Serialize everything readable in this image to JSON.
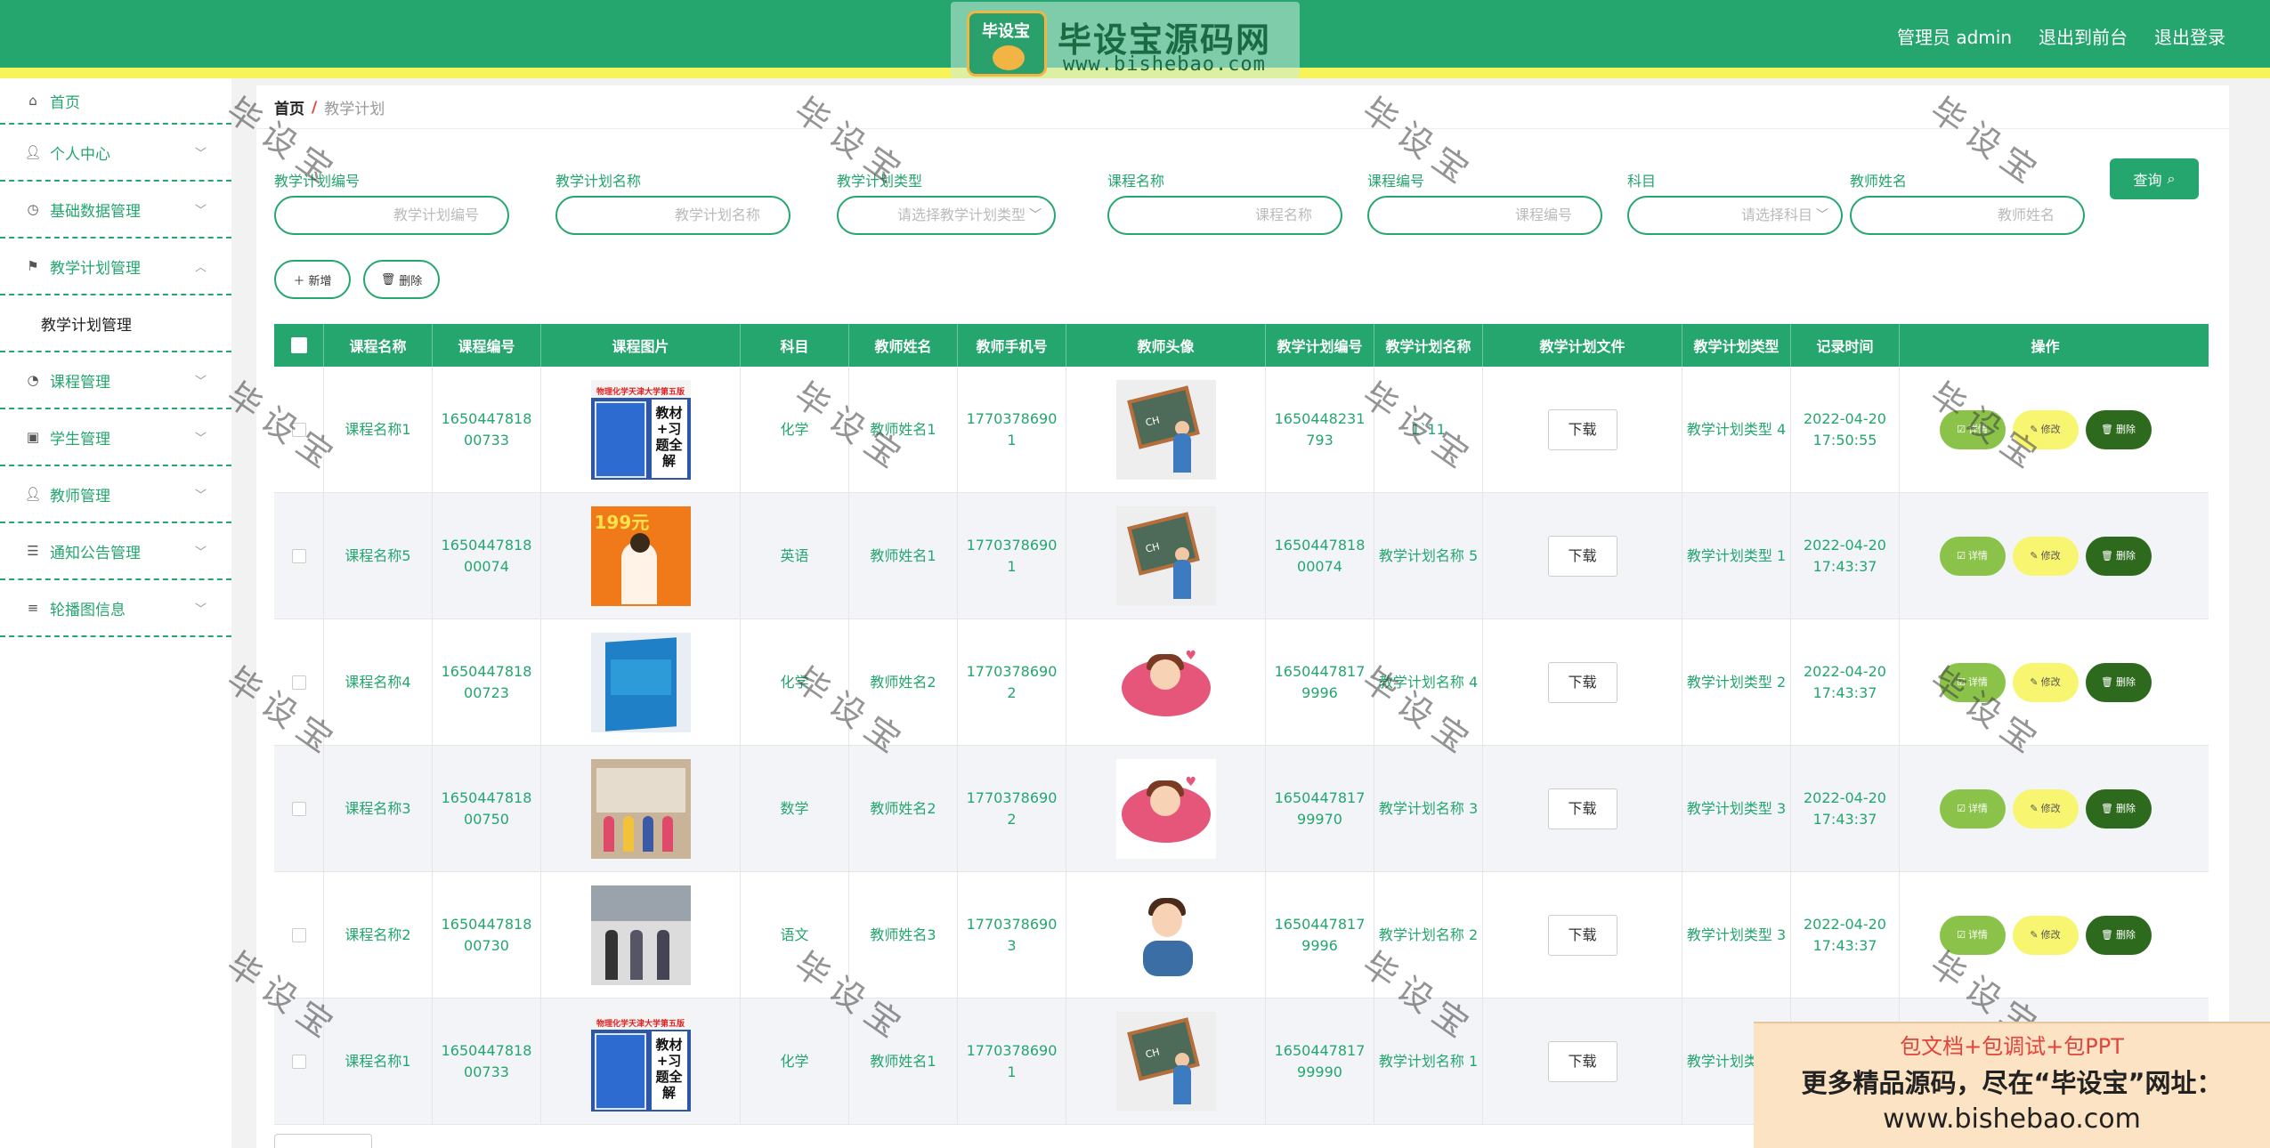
{
  "header": {
    "admin_label": "管理员 admin",
    "front_link": "退出到前台",
    "logout_link": "退出登录",
    "logo_badge": "毕设宝",
    "logo_title": "毕设宝源码网",
    "logo_url": "www.bishebao.com"
  },
  "sidebar": {
    "home": "首页",
    "items": [
      {
        "label": "个人中心",
        "icon": "user-icon"
      },
      {
        "label": "基础数据管理",
        "icon": "clock-icon"
      },
      {
        "label": "教学计划管理",
        "icon": "flag-icon",
        "expanded": true
      },
      {
        "label": "课程管理",
        "icon": "compass-icon"
      },
      {
        "label": "学生管理",
        "icon": "clipboard-icon"
      },
      {
        "label": "教师管理",
        "icon": "user-icon"
      },
      {
        "label": "通知公告管理",
        "icon": "sliders-icon"
      },
      {
        "label": "轮播图信息",
        "icon": "list-icon"
      }
    ],
    "submenu": "教学计划管理"
  },
  "breadcrumb": {
    "home": "首页",
    "sep": "/",
    "current": "教学计划"
  },
  "filters": [
    {
      "label": "教学计划编号",
      "placeholder": "教学计划编号"
    },
    {
      "label": "教学计划名称",
      "placeholder": "教学计划名称"
    },
    {
      "label": "教学计划类型",
      "placeholder": "请选择教学计划类型"
    },
    {
      "label": "课程名称",
      "placeholder": "课程名称"
    },
    {
      "label": "课程编号",
      "placeholder": "课程编号"
    },
    {
      "label": "科目",
      "placeholder": "请选择科目"
    },
    {
      "label": "教师姓名",
      "placeholder": "教师姓名"
    }
  ],
  "buttons": {
    "query": "查询",
    "add": "新增",
    "delete": "删除"
  },
  "table": {
    "headers": [
      "课程名称",
      "课程编号",
      "课程图片",
      "科目",
      "教师姓名",
      "教师手机号",
      "教师头像",
      "教学计划编号",
      "教学计划名称",
      "教学计划文件",
      "教学计划类型",
      "记录时间",
      "操作"
    ],
    "download_label": "下载",
    "op_labels": {
      "detail": "详情",
      "edit": "修改",
      "del": "删除"
    },
    "rows": [
      {
        "course": "课程名称1",
        "code": "1650447818 00733",
        "subject": "化学",
        "teacher": "教师姓名1",
        "phone": "1770378690 1",
        "plan_no": "1650448231 793",
        "plan_name": "1`11",
        "type": "教学计划类型 4",
        "time": "2022-04-20 17:50:55",
        "pic": "book-blue",
        "avatar": "av-board"
      },
      {
        "course": "课程名称5",
        "code": "1650447818 00074",
        "subject": "英语",
        "teacher": "教师姓名1",
        "phone": "1770378690 1",
        "plan_no": "1650447818 00074",
        "plan_name": "教学计划名称 5",
        "type": "教学计划类型 1",
        "time": "2022-04-20 17:43:37",
        "pic": "book-orange",
        "avatar": "av-board"
      },
      {
        "course": "课程名称4",
        "code": "1650447818 00723",
        "subject": "化学",
        "teacher": "教师姓名2",
        "phone": "1770378690 2",
        "plan_no": "1650447817 9996",
        "plan_name": "教学计划名称 4",
        "type": "教学计划类型 2",
        "time": "2022-04-20 17:43:37",
        "pic": "book-tech",
        "avatar": "av-girl"
      },
      {
        "course": "课程名称3",
        "code": "1650447818 00750",
        "subject": "数学",
        "teacher": "教师姓名2",
        "phone": "1770378690 2",
        "plan_no": "1650447817 99970",
        "plan_name": "教学计划名称 3",
        "type": "教学计划类型 3",
        "time": "2022-04-20 17:43:37",
        "pic": "photo-class",
        "avatar": "av-girl"
      },
      {
        "course": "课程名称2",
        "code": "1650447818 00730",
        "subject": "语文",
        "teacher": "教师姓名3",
        "phone": "1770378690 3",
        "plan_no": "1650447817 9996",
        "plan_name": "教学计划名称 2",
        "type": "教学计划类型 3",
        "time": "2022-04-20 17:43:37",
        "pic": "photo-office",
        "avatar": "av-boy"
      },
      {
        "course": "课程名称1",
        "code": "1650447818 00733",
        "subject": "化学",
        "teacher": "教师姓名1",
        "phone": "1770378690 1",
        "plan_no": "1650447817 99990",
        "plan_name": "教学计划名称 1",
        "type": "教学计划类型 3",
        "time": "",
        "pic": "book-blue",
        "avatar": "av-board"
      }
    ]
  },
  "book_text": {
    "top": "物理化学天津大学第五版",
    "title": "教材+习题全解",
    "orange": "199元"
  },
  "board_text": "CH",
  "watermark": "毕设宝",
  "ad": {
    "line1": "包文档+包调试+包PPT",
    "line2": "更多精品源码，尽在“毕设宝”网址：",
    "line3": "www.bishebao.com"
  }
}
